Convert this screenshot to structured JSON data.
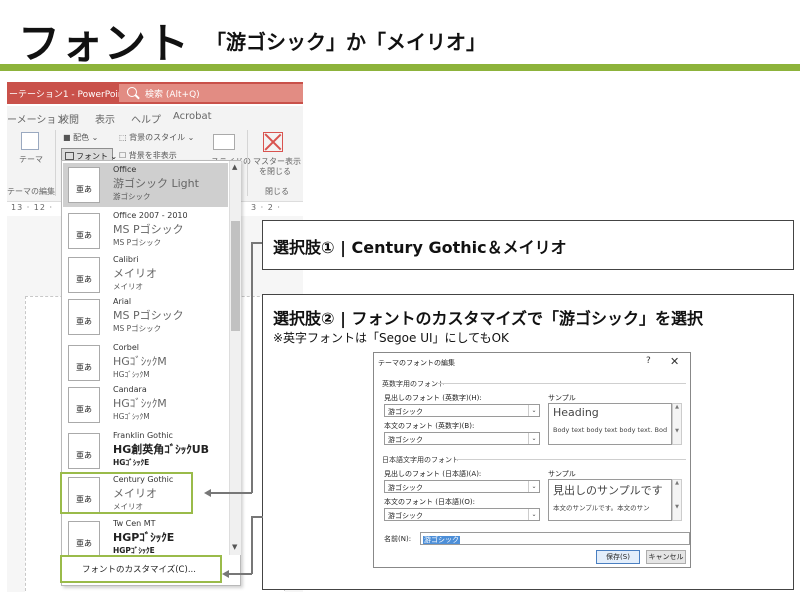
{
  "slide": {
    "title": "フォント",
    "subtitle": "「游ゴシック」か「メイリオ」",
    "accent_color": "#8db33b"
  },
  "powerpoint": {
    "window_title": "ーテーション1 - PowerPoint",
    "search_placeholder": "検索 (Alt+Q)",
    "tabs": [
      "ーメーション",
      "校閲",
      "表示",
      "ヘルプ",
      "Acrobat"
    ],
    "ribbon": {
      "theme_label": "テーマ",
      "theme_edit_label": "テーマの編集",
      "color_label": "配色",
      "background_style_label": "背景のスタイル",
      "font_button_label": "フォント",
      "hide_background_label": "背景を非表示",
      "slide_label": "スライドの",
      "close_master_label_1": "マスター表示",
      "close_master_label_2": "を閉じる",
      "close_group_label": "閉じる"
    },
    "ruler_text": "13 · 12 ·",
    "ruler_text_right": "3 · 2 ·",
    "font_themes": [
      {
        "name": "Office",
        "heading": "游ゴシック Light",
        "body": "游ゴシック",
        "preview": "亜あ"
      },
      {
        "name": "Office 2007 - 2010",
        "heading": "MS Pゴシック",
        "body": "MS Pゴシック",
        "preview": "亜あ"
      },
      {
        "name": "Calibri",
        "heading": "メイリオ",
        "body": "メイリオ",
        "preview": "亜あ"
      },
      {
        "name": "Arial",
        "heading": "MS Pゴシック",
        "body": "MS Pゴシック",
        "preview": "亜あ"
      },
      {
        "name": "Corbel",
        "heading": "HGｺﾞｼｯｸM",
        "body": "HGｺﾞｼｯｸM",
        "preview": "亜あ"
      },
      {
        "name": "Candara",
        "heading": "HGｺﾞｼｯｸM",
        "body": "HGｺﾞｼｯｸM",
        "preview": "亜あ"
      },
      {
        "name": "Franklin Gothic",
        "heading": "HG創英角ｺﾞｼｯｸUB",
        "body": "HGｺﾞｼｯｸE",
        "preview": "亜あ"
      },
      {
        "name": "Century Gothic",
        "heading": "メイリオ",
        "body": "メイリオ",
        "preview": "亜あ"
      },
      {
        "name": "Tw Cen MT",
        "heading": "HGPｺﾞｼｯｸE",
        "body": "HGPｺﾞｼｯｸE",
        "preview": "亜あ"
      }
    ],
    "customize_label": "フォントのカスタマイズ(C)..."
  },
  "callout1": {
    "text": "選択肢① | Century Gothic＆メイリオ"
  },
  "callout2": {
    "text": "選択肢② | フォントのカスタマイズで「游ゴシック」を選択",
    "note": "※英字フォントは「Segoe UI」にしてもOK"
  },
  "dialog": {
    "title": "テーマのフォントの編集",
    "help": "?",
    "close": "✕",
    "latin_section": "英数字用のフォント",
    "latin_heading_label": "見出しのフォント (英数字)(H):",
    "latin_heading_value": "游ゴシック",
    "latin_body_label": "本文のフォント (英数字)(B):",
    "latin_body_value": "游ゴシック",
    "sample_label": "サンプル",
    "latin_sample_heading": "Heading",
    "latin_sample_body": "Body text body text body text. Bod",
    "ea_section": "日本語文字用のフォント",
    "ea_heading_label": "見出しのフォント (日本語)(A):",
    "ea_heading_value": "游ゴシック",
    "ea_body_label": "本文のフォント (日本語)(O):",
    "ea_body_value": "游ゴシック",
    "ea_sample_heading": "見出しのサンプルです",
    "ea_sample_body": "本文のサンプルです。本文のサン",
    "name_label": "名前(N):",
    "name_value": "游ゴシック",
    "save_button": "保存(S)",
    "cancel_button": "キャンセル"
  }
}
